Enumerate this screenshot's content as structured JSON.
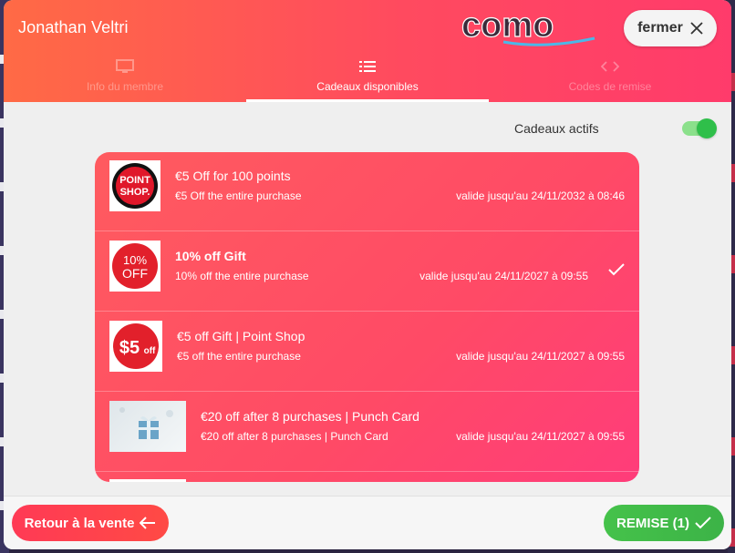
{
  "header": {
    "member_name": "Jonathan Veltri",
    "logo_text": "como",
    "close_label": "fermer"
  },
  "tabs": [
    {
      "label": "Info du membre",
      "icon": "monitor-icon",
      "active": false
    },
    {
      "label": "Cadeaux disponibles",
      "icon": "list-icon",
      "active": true
    },
    {
      "label": "Codes de remise",
      "icon": "code-icon",
      "active": false
    }
  ],
  "toggle": {
    "label": "Cadeaux actifs",
    "on": true
  },
  "gifts": [
    {
      "title": "€5 Off for 100 points",
      "subtitle": "€5 Off the entire purchase",
      "validity": "valide jusqu'au 24/11/2032 à 08:46",
      "image": "point-shop-image",
      "image_text": [
        "POINT",
        "SHOP."
      ],
      "selected": false
    },
    {
      "title": "10% off Gift",
      "subtitle": "10% off the entire purchase",
      "validity": "valide jusqu'au 24/11/2027 à 09:55",
      "image": "ten-percent-off-image",
      "image_text": [
        "10%",
        "OFF"
      ],
      "selected": true
    },
    {
      "title": "€5 off Gift | Point Shop",
      "subtitle": "€5 off the entire purchase",
      "validity": "valide jusqu'au 24/11/2027 à 09:55",
      "image": "five-off-image",
      "image_text": [
        "$5",
        "off"
      ],
      "selected": false
    },
    {
      "title": "€20 off after 8 purchases | Punch Card",
      "subtitle": "€20 off after 8 purchases | Punch Card",
      "validity": "valide jusqu'au 24/11/2027 à 09:55",
      "image": "gift-box-image",
      "image_text": [],
      "selected": false
    }
  ],
  "footer": {
    "back_label": "Retour à la vente",
    "discount_label": "REMISE (1)"
  },
  "colors": {
    "header_start": "#ff6a45",
    "header_end": "#ff3b6b",
    "gift_list": "#ff4a66",
    "accent_green": "#3cb347",
    "back_red": "#ff3a55"
  }
}
